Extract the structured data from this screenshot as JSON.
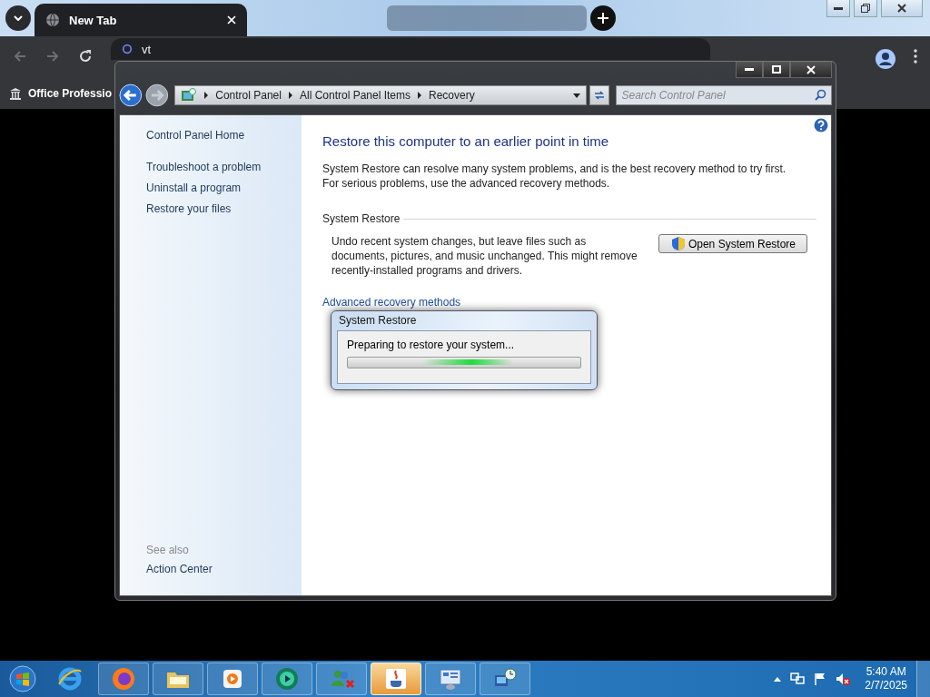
{
  "browser": {
    "tabs": [
      {
        "label": "New Tab",
        "selected": true
      },
      {
        "selected": false
      }
    ],
    "address": "vt",
    "bookmarks": [
      "Office Professio"
    ]
  },
  "window": {
    "breadcrumb": [
      "Control Panel",
      "All Control Panel Items",
      "Recovery"
    ],
    "search": {
      "placeholder": "Search Control Panel"
    }
  },
  "sidebar": {
    "links": [
      "Control Panel Home",
      "Troubleshoot a problem",
      "Uninstall a program",
      "Restore your files"
    ],
    "see_also": {
      "label": "See also",
      "items": [
        "Action Center"
      ]
    }
  },
  "main": {
    "heading": "Restore this computer to an earlier point in time",
    "intro": "System Restore can resolve many system problems, and is the best recovery method to try first. For serious problems, use the advanced recovery methods.",
    "section": "System Restore",
    "description": "Undo recent system changes, but leave files such as documents, pictures, and music unchanged. This might remove recently-installed programs and drivers.",
    "button": "Open System Restore",
    "link": "Advanced recovery methods"
  },
  "dialog": {
    "title": "System Restore",
    "message": "Preparing to restore your system...",
    "level": 0.71
  },
  "taskbar": {
    "apps": [
      {
        "kind": "ie",
        "selected": false
      },
      {
        "kind": "firefox",
        "selected": false
      },
      {
        "kind": "folder",
        "selected": false
      },
      {
        "kind": "media",
        "selected": false
      },
      {
        "kind": "player",
        "selected": false
      },
      {
        "kind": "users",
        "selected": false
      },
      {
        "kind": "java",
        "selected": true
      },
      {
        "kind": "panel",
        "selected": false
      },
      {
        "kind": "network",
        "selected": false
      }
    ],
    "time": "5:40 AM",
    "date": "2/7/2025"
  }
}
